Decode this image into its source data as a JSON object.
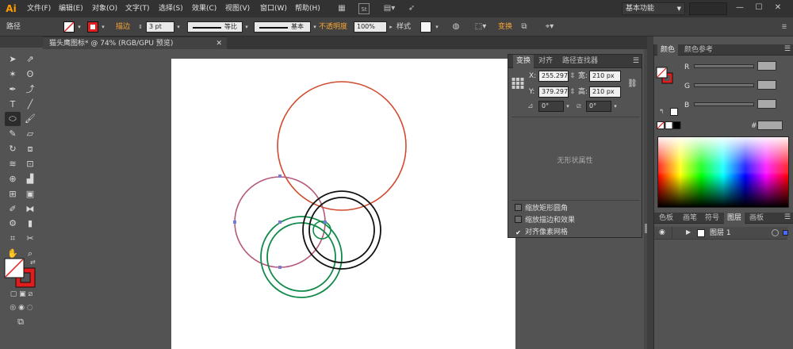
{
  "app": {
    "logo": "Ai",
    "menu": [
      "文件(F)",
      "编辑(E)",
      "对象(O)",
      "文字(T)",
      "选择(S)",
      "效果(C)",
      "视图(V)",
      "窗口(W)",
      "帮助(H)"
    ],
    "st_badge": "St",
    "workspace": "基本功能",
    "window_controls": [
      "—",
      "☐",
      "✕"
    ]
  },
  "control_bar": {
    "selection_label": "路径",
    "stroke_label": "描边",
    "stroke_value": "3 pt",
    "profile_label": "等比",
    "brush_label": "基本",
    "opacity_label": "不透明度",
    "opacity_value": "100%",
    "style_label": "样式",
    "transform_label": "变换"
  },
  "document": {
    "tab_title": "猫头鹰图标* @ 74% (RGB/GPU 预览)",
    "close": "✕"
  },
  "shapes": [
    {
      "name": "red-circle",
      "color": "#d24a2e"
    },
    {
      "name": "pink-circle",
      "color": "#b4587e"
    },
    {
      "name": "green-outer-circle",
      "color": "#128a4a"
    },
    {
      "name": "green-inner-circle",
      "color": "#128a4a"
    },
    {
      "name": "black-outer-circle",
      "color": "#111111"
    },
    {
      "name": "black-inner-circle",
      "color": "#111111"
    },
    {
      "name": "small-green-circle",
      "color": "#128a4a"
    },
    {
      "name": "anchor-point",
      "color": "#7a7ad0"
    }
  ],
  "transform_panel": {
    "tabs": [
      "变换",
      "对齐",
      "路径查找器"
    ],
    "x_label": "X:",
    "x_value": "255.297",
    "y_label": "Y:",
    "y_value": "379.297",
    "w_label": "宽:",
    "w_value": "210 px",
    "h_label": "高:",
    "h_value": "210 px",
    "rotate_value": "0°",
    "shear_value": "0°",
    "no_shape_props": "无形状属性",
    "options": [
      {
        "label": "缩放矩形圆角",
        "checked": false
      },
      {
        "label": "缩放描边和效果",
        "checked": false
      },
      {
        "label": "对齐像素网格",
        "checked": true
      }
    ]
  },
  "color_panel": {
    "tabs": [
      "颜色",
      "颜色参考"
    ],
    "r_label": "R",
    "g_label": "G",
    "b_label": "B",
    "hex_label": "#"
  },
  "layers_panel": {
    "tabs": [
      "色板",
      "画笔",
      "符号",
      "图层",
      "画板"
    ],
    "layer_name": "图层 1"
  }
}
